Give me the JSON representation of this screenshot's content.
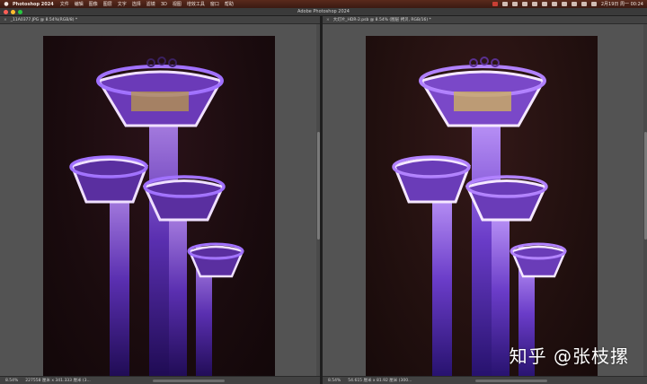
{
  "menubar": {
    "apple_label": "",
    "app_name": "Photoshop 2024",
    "items": [
      "文件",
      "编辑",
      "图像",
      "图层",
      "文字",
      "选择",
      "滤镜",
      "3D",
      "视图",
      "增效工具",
      "窗口",
      "帮助"
    ],
    "clock": "2月19日 周一  00:24"
  },
  "window": {
    "title": "Adobe Photoshop 2024"
  },
  "left_doc": {
    "tab_title": "_11A0377.JPG @ 8.54%(RGB/8) *",
    "zoom": "8.54%",
    "size_info": "227558 厘米 x 341.333 厘米 (3..."
  },
  "right_doc": {
    "tab_title": "大灯片_HDR-2.psb @ 8.54% (图层 拷贝, RGB/16) *",
    "zoom": "8.54%",
    "size_info": "54.615 厘米 x 81.92 厘米 (300..."
  },
  "watermark": "知乎 @张枝摞",
  "colors": {
    "accent_purple": "#c8a2ff",
    "menubar_bg": "#4a2218",
    "panel_bg": "#535353"
  }
}
